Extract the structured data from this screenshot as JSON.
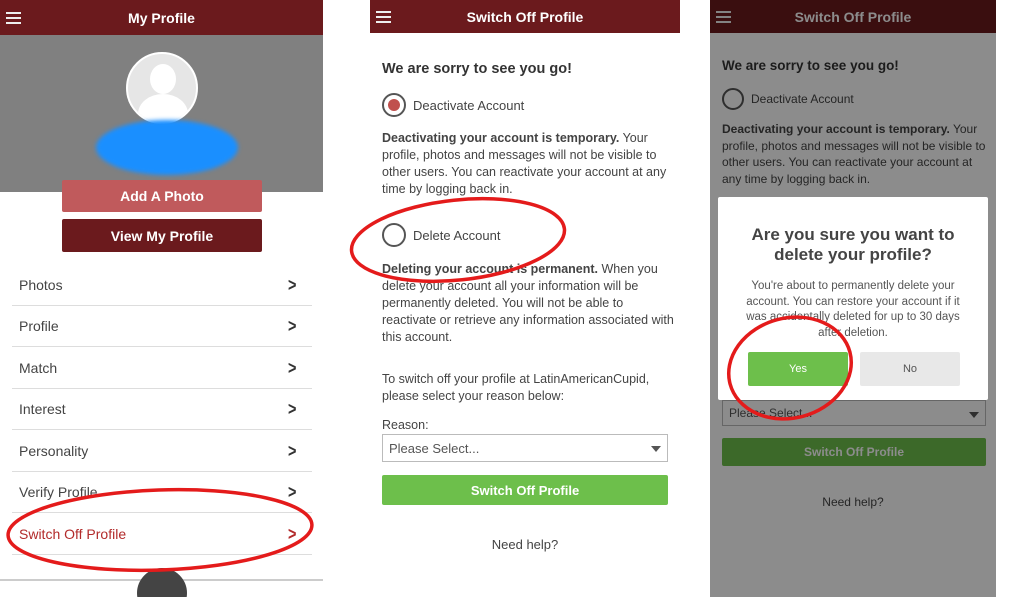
{
  "colors": {
    "header": "#6b1a1d",
    "add_photo": "#c05a5c",
    "green": "#6dbf4b",
    "annotation": "#e41b1b",
    "redact": "#1a8fff"
  },
  "screen1": {
    "title": "My Profile",
    "add_photo": "Add A Photo",
    "view_profile": "View My Profile",
    "items": [
      {
        "label": "Photos"
      },
      {
        "label": "Profile"
      },
      {
        "label": "Match"
      },
      {
        "label": "Interest"
      },
      {
        "label": "Personality"
      },
      {
        "label": "Verify Profile"
      },
      {
        "label": "Switch Off Profile"
      }
    ]
  },
  "screen2": {
    "title": "Switch Off Profile",
    "heading": "We are sorry to see you go!",
    "deactivate_label": "Deactivate Account",
    "deactivate_bold": "Deactivating your account is temporary.",
    "deactivate_text": " Your profile, photos and messages will not be visible to other users. You can reactivate your account at any time by logging back in.",
    "delete_label": "Delete Account",
    "delete_bold": "Deleting your account is permanent.",
    "delete_text": " When you delete your account all your information will be permanently deleted. You will not be able to reactivate or retrieve any information associated with this account.",
    "instructions": "To switch off your profile at LatinAmericanCupid, please select your reason below:",
    "reason_label": "Reason:",
    "reason_value": "Please Select...",
    "submit": "Switch Off Profile",
    "help": "Need help?",
    "selected": "deactivate"
  },
  "screen3": {
    "title": "Switch Off Profile",
    "heading": "We are sorry to see you go!",
    "deactivate_label": "Deactivate Account",
    "deactivate_bold": "Deactivating your account is temporary.",
    "deactivate_text": " Your profile, photos and messages will not be visible to other users. You can reactivate your account at any time by logging back in.",
    "reason_value": "Please Select...",
    "submit": "Switch Off Profile",
    "help": "Need help?",
    "dialog": {
      "title": "Are you sure you want to delete your profile?",
      "message": "You're about to permanently delete your account. You can restore your account if it was accidentally deleted for up to 30 days after deletion.",
      "yes": "Yes",
      "no": "No"
    }
  }
}
